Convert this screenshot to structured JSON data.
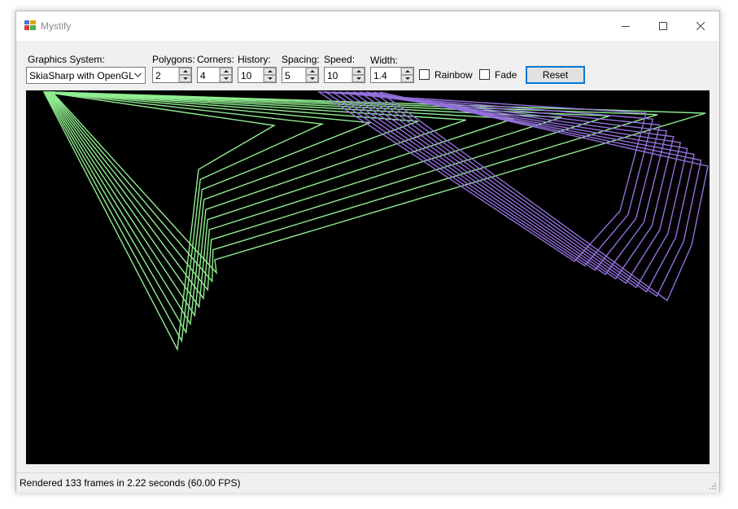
{
  "window": {
    "title": "Mystify"
  },
  "toolbar": {
    "graphics_label": "Graphics System:",
    "graphics_value": "SkiaSharp with OpenGL",
    "polygons_label": "Polygons:",
    "polygons_value": "2",
    "corners_label": "Corners:",
    "corners_value": "4",
    "history_label": "History:",
    "history_value": "10",
    "spacing_label": "Spacing:",
    "spacing_value": "5",
    "speed_label": "Speed:",
    "speed_value": "10",
    "width_label": "Width:",
    "width_value": "1.4",
    "rainbow_label": "Rainbow",
    "rainbow_checked": false,
    "fade_label": "Fade",
    "fade_checked": false,
    "reset_label": "Reset"
  },
  "canvas": {
    "background": "#000000",
    "polygon_colors": [
      "#90ee90",
      "#9370db"
    ]
  },
  "status": {
    "text": "Rendered 133 frames in 2.22 seconds (60.00 FPS)"
  }
}
